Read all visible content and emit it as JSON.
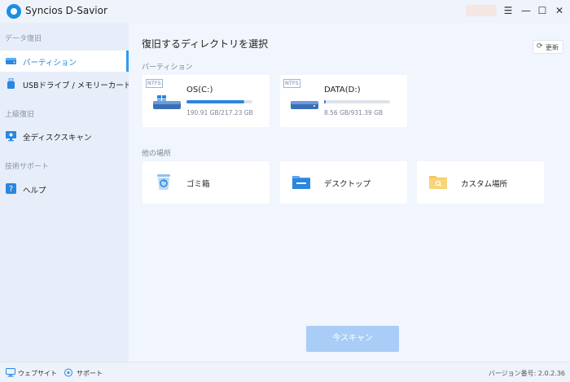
{
  "app": {
    "title": "Syncios D-Savior"
  },
  "window_controls": {
    "menu": "☰",
    "minimize": "—",
    "maximize": "☐",
    "close": "✕"
  },
  "sidebar": {
    "sections": [
      {
        "label": "データ復旧"
      },
      {
        "label": "上級復旧"
      },
      {
        "label": "技術サポート"
      }
    ],
    "items": [
      {
        "label": "パーティション",
        "icon": "drive-icon",
        "active": true
      },
      {
        "label": "USBドライブ / メモリーカード",
        "icon": "usb-icon",
        "active": false
      },
      {
        "label": "全ディスクスキャン",
        "icon": "monitor-icon",
        "active": false
      },
      {
        "label": "ヘルプ",
        "icon": "question-icon",
        "active": false
      }
    ]
  },
  "main": {
    "title": "復旧するディレクトリを選択",
    "refresh_label": "更新",
    "partitions_label": "パーティション",
    "drives": [
      {
        "fs": "NTFS",
        "name": "OS(C:)",
        "size": "190.91 GB/217.23 GB",
        "used_fraction": 0.879,
        "icon": "windows-drive-icon"
      },
      {
        "fs": "NTFS",
        "name": "DATA(D:)",
        "size": "8.56 GB/931.39 GB",
        "used_fraction": 0.009,
        "icon": "hard-drive-icon"
      }
    ],
    "other_label": "他の場所",
    "locations": [
      {
        "name": "ゴミ箱",
        "icon": "recycle-bin-icon"
      },
      {
        "name": "デスクトップ",
        "icon": "desktop-folder-icon"
      },
      {
        "name": "カスタム場所",
        "icon": "custom-folder-icon"
      }
    ],
    "scan_button": "今スキャン"
  },
  "footer": {
    "website": "ウェブサイト",
    "support": "サポート",
    "version": "バージョン番号: 2.0.2.36"
  },
  "colors": {
    "accent": "#2e9bf0",
    "scan_button": "#a9cdf6",
    "sidebar_bg": "#e7eefa",
    "main_bg": "#f1f5fd"
  }
}
